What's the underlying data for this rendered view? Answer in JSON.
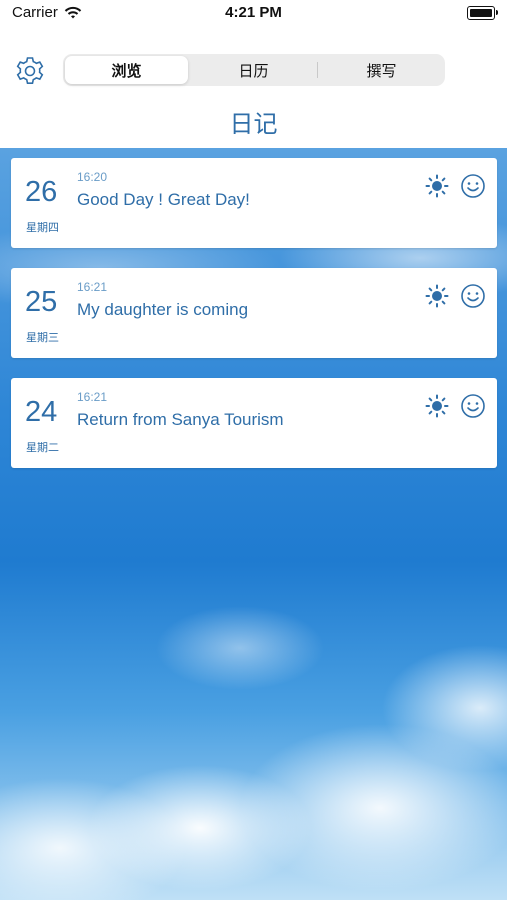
{
  "status": {
    "carrier": "Carrier",
    "time": "4:21 PM"
  },
  "header": {
    "tabs": [
      {
        "label": "浏览",
        "active": true
      },
      {
        "label": "日历",
        "active": false
      },
      {
        "label": "撰写",
        "active": false
      }
    ],
    "title": "日记"
  },
  "entries": [
    {
      "day": "26",
      "weekday": "星期四",
      "time": "16:20",
      "title": "Good Day ! Great Day!",
      "weather": "sun-icon",
      "mood": "smile-icon"
    },
    {
      "day": "25",
      "weekday": "星期三",
      "time": "16:21",
      "title": "My daughter is coming",
      "weather": "sun-icon",
      "mood": "smile-icon"
    },
    {
      "day": "24",
      "weekday": "星期二",
      "time": "16:21",
      "title": "Return from Sanya Tourism",
      "weather": "sun-icon",
      "mood": "smile-icon"
    }
  ],
  "colors": {
    "accent": "#2f6ea8",
    "time": "#6a9cc7"
  }
}
